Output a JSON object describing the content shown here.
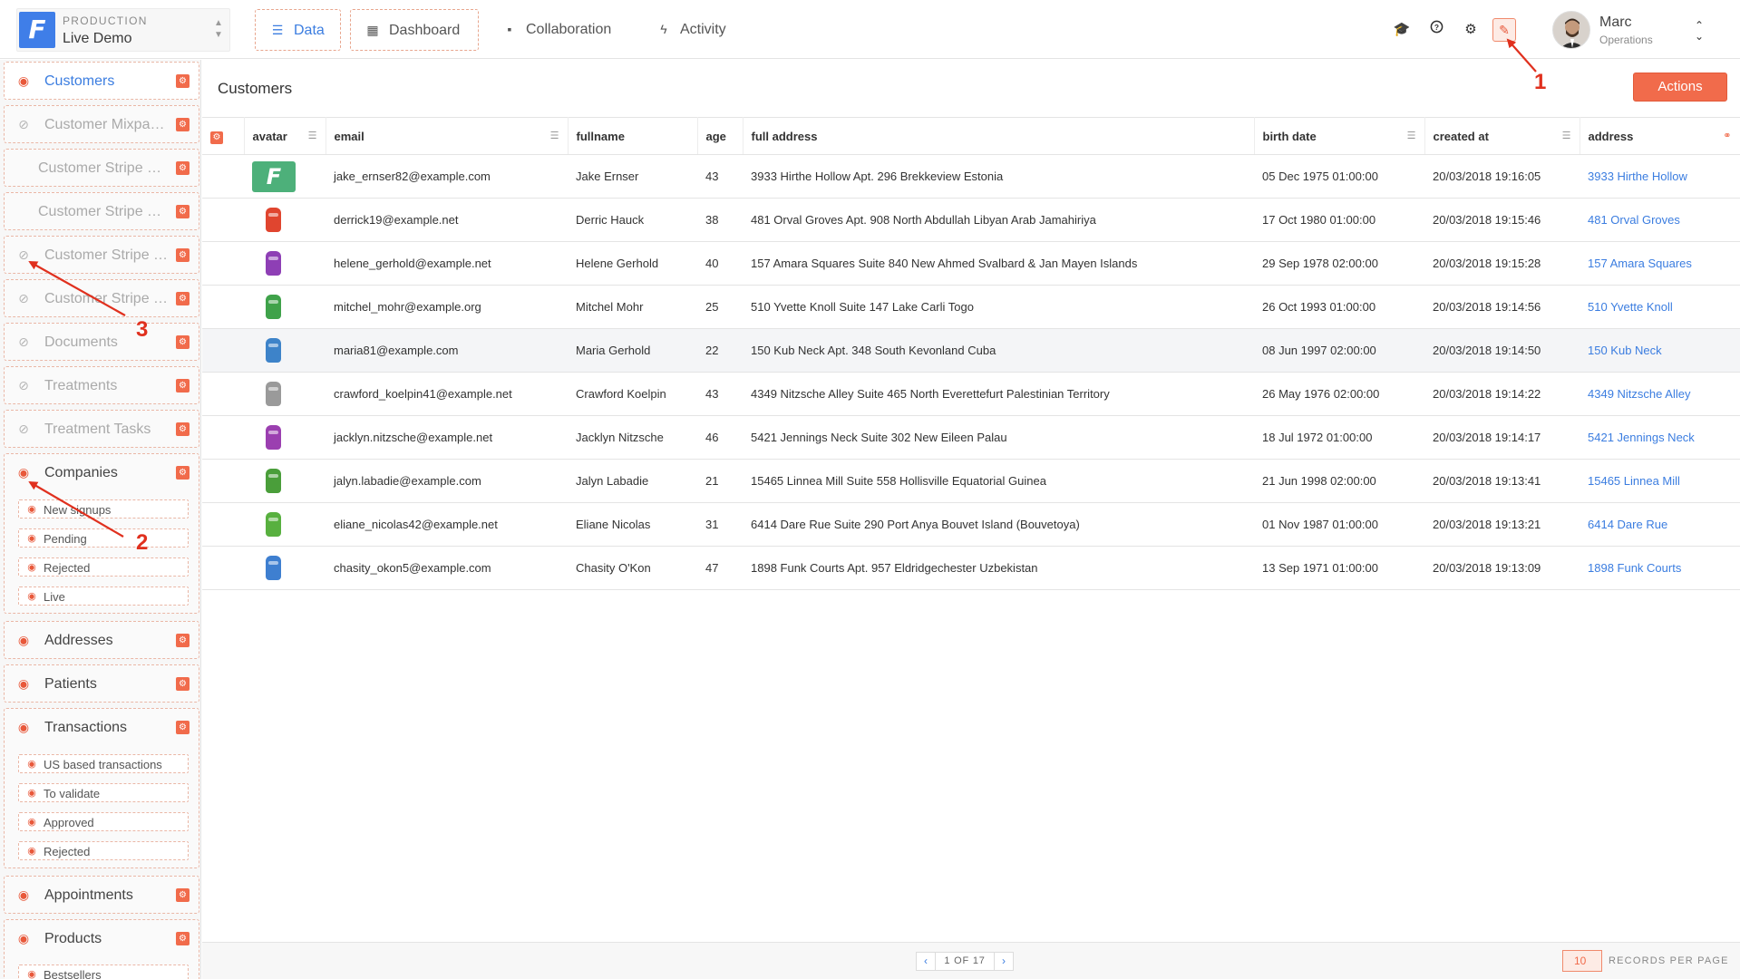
{
  "env": {
    "kicker": "PRODUCTION",
    "name": "Live Demo",
    "logo": "F"
  },
  "nav": [
    {
      "label": "Data",
      "icon": "list-icon",
      "active": true
    },
    {
      "label": "Dashboard",
      "icon": "dashboard-icon",
      "active": false
    },
    {
      "label": "Collaboration",
      "icon": "chat-icon",
      "active": false
    },
    {
      "label": "Activity",
      "icon": "bolt-icon",
      "active": false
    }
  ],
  "user": {
    "name": "Marc",
    "role": "Operations"
  },
  "sidebar": {
    "collections": [
      {
        "label": "Customers",
        "visible": true,
        "active": true
      },
      {
        "label": "Customer Mixpanel Events",
        "visible": false
      },
      {
        "label": "Customer Stripe Balance",
        "visible": false,
        "smart": true
      },
      {
        "label": "Customer Stripe Cards",
        "visible": false,
        "smart": true
      },
      {
        "label": "Customer Stripe Invoices",
        "visible": false
      },
      {
        "label": "Customer Stripe Subscriptions",
        "visible": false
      },
      {
        "label": "Documents",
        "visible": false
      },
      {
        "label": "Treatments",
        "visible": false
      },
      {
        "label": "Treatment Tasks",
        "visible": false
      },
      {
        "label": "Companies",
        "visible": true
      },
      {
        "label": "Addresses",
        "visible": true
      },
      {
        "label": "Patients",
        "visible": true
      },
      {
        "label": "Transactions",
        "visible": true
      },
      {
        "label": "Appointments",
        "visible": true
      },
      {
        "label": "Products",
        "visible": true
      }
    ],
    "companies_segments": [
      "New signups",
      "Pending",
      "Rejected",
      "Live"
    ],
    "transactions_segments": [
      "US based transactions",
      "To validate",
      "Approved",
      "Rejected"
    ],
    "products_segments": [
      "Bestsellers"
    ]
  },
  "main": {
    "title": "Customers",
    "actions_label": "Actions",
    "columns": [
      "avatar",
      "email",
      "fullname",
      "age",
      "full address",
      "birth date",
      "created at",
      "address"
    ],
    "rows": [
      {
        "email": "jake_ernser82@example.com",
        "fullname": "Jake Ernser",
        "age": "43",
        "full_address": "3933 Hirthe Hollow Apt. 296 Brekkeview Estonia",
        "birth_date": "05 Dec 1975 01:00:00",
        "created_at": "20/03/2018 19:16:05",
        "address": "3933 Hirthe Hollow",
        "avatar_color": "#4db07a"
      },
      {
        "email": "derrick19@example.net",
        "fullname": "Derric Hauck",
        "age": "38",
        "full_address": "481 Orval Groves Apt. 908 North Abdullah Libyan Arab Jamahiriya",
        "birth_date": "17 Oct 1980 01:00:00",
        "created_at": "20/03/2018 19:15:46",
        "address": "481 Orval Groves",
        "avatar_color": "#e0452f"
      },
      {
        "email": "helene_gerhold@example.net",
        "fullname": "Helene Gerhold",
        "age": "40",
        "full_address": "157 Amara Squares Suite 840 New Ahmed Svalbard & Jan Mayen Islands",
        "birth_date": "29 Sep 1978 02:00:00",
        "created_at": "20/03/2018 19:15:28",
        "address": "157 Amara Squares",
        "avatar_color": "#8e3fb5"
      },
      {
        "email": "mitchel_mohr@example.org",
        "fullname": "Mitchel Mohr",
        "age": "25",
        "full_address": "510 Yvette Knoll Suite 147 Lake Carli Togo",
        "birth_date": "26 Oct 1993 01:00:00",
        "created_at": "20/03/2018 19:14:56",
        "address": "510 Yvette Knoll",
        "avatar_color": "#3fa24a"
      },
      {
        "email": "maria81@example.com",
        "fullname": "Maria Gerhold",
        "age": "22",
        "full_address": "150 Kub Neck Apt. 348 South Kevonland Cuba",
        "birth_date": "08 Jun 1997 02:00:00",
        "created_at": "20/03/2018 19:14:50",
        "address": "150 Kub Neck",
        "avatar_color": "#3d83c9"
      },
      {
        "email": "crawford_koelpin41@example.net",
        "fullname": "Crawford Koelpin",
        "age": "43",
        "full_address": "4349 Nitzsche Alley Suite 465 North Everettefurt Palestinian Territory",
        "birth_date": "26 May 1976 02:00:00",
        "created_at": "20/03/2018 19:14:22",
        "address": "4349 Nitzsche Alley",
        "avatar_color": "#9a9a9a"
      },
      {
        "email": "jacklyn.nitzsche@example.net",
        "fullname": "Jacklyn Nitzsche",
        "age": "46",
        "full_address": "5421 Jennings Neck Suite 302 New Eileen Palau",
        "birth_date": "18 Jul 1972 01:00:00",
        "created_at": "20/03/2018 19:14:17",
        "address": "5421 Jennings Neck",
        "avatar_color": "#9b3fb0"
      },
      {
        "email": "jalyn.labadie@example.com",
        "fullname": "Jalyn Labadie",
        "age": "21",
        "full_address": "15465 Linnea Mill Suite 558 Hollisville Equatorial Guinea",
        "birth_date": "21 Jun 1998 02:00:00",
        "created_at": "20/03/2018 19:13:41",
        "address": "15465 Linnea Mill",
        "avatar_color": "#4a9e3a"
      },
      {
        "email": "eliane_nicolas42@example.net",
        "fullname": "Eliane Nicolas",
        "age": "31",
        "full_address": "6414 Dare Rue Suite 290 Port Anya Bouvet Island (Bouvetoya)",
        "birth_date": "01 Nov 1987 01:00:00",
        "created_at": "20/03/2018 19:13:21",
        "address": "6414 Dare Rue",
        "avatar_color": "#58b03f"
      },
      {
        "email": "chasity_okon5@example.com",
        "fullname": "Chasity O'Kon",
        "age": "47",
        "full_address": "1898 Funk Courts Apt. 957 Eldridgechester Uzbekistan",
        "birth_date": "13 Sep 1971 01:00:00",
        "created_at": "20/03/2018 19:13:09",
        "address": "1898 Funk Courts",
        "avatar_color": "#3e7fd0"
      }
    ],
    "highlighted_row": 4,
    "pagination": {
      "label": "1 OF 17",
      "per_page": "10",
      "per_page_label": "RECORDS PER PAGE"
    }
  },
  "annotations": [
    "1",
    "2",
    "3"
  ],
  "colors": {
    "accent": "#f16b4b",
    "link": "#3b7de0",
    "annotation": "#e0301e"
  }
}
